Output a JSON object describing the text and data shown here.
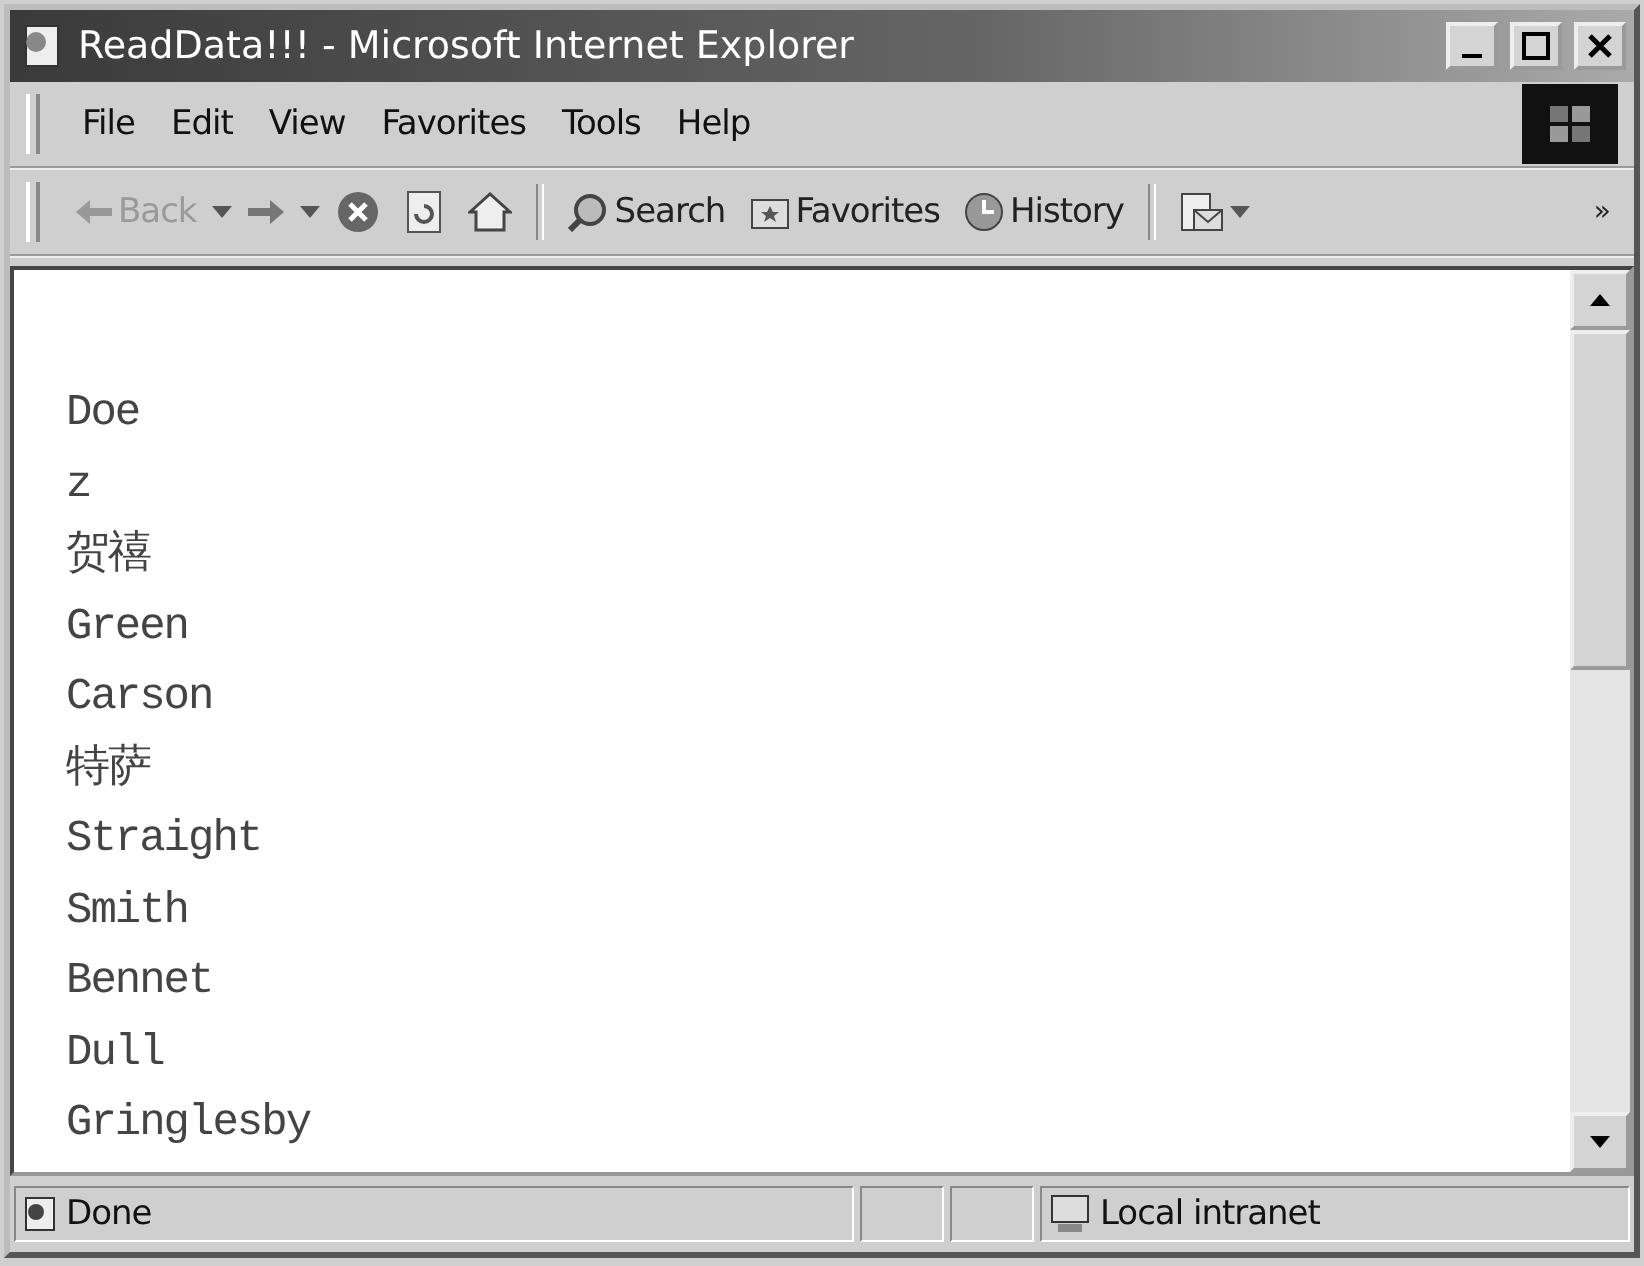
{
  "window": {
    "title": "ReadData!!! - Microsoft Internet Explorer"
  },
  "menu": [
    "File",
    "Edit",
    "View",
    "Favorites",
    "Tools",
    "Help"
  ],
  "toolbar": {
    "back": {
      "label": "Back",
      "disabled": true
    },
    "search": "Search",
    "favorites": "Favorites",
    "history": "History",
    "more": "»"
  },
  "content": {
    "lines": [
      "Doe",
      "z",
      "贺禧",
      "Green",
      "Carson",
      "特萨",
      "Straight",
      "Smith",
      "Bennet",
      "Dull",
      "Gringlesby"
    ]
  },
  "status_bar": {
    "text": "Done",
    "zone": "Local intranet"
  }
}
